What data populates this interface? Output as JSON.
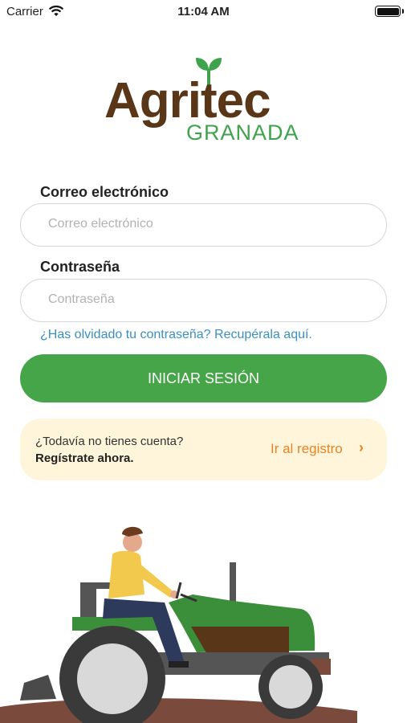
{
  "status_bar": {
    "carrier": "Carrier",
    "time": "11:04 AM",
    "icons": [
      "wifi-icon",
      "battery-icon"
    ]
  },
  "logo": {
    "word": "Agritec",
    "subtitle": "GRANADA",
    "colors": {
      "brown": "#5a3618",
      "green": "#3fa34d"
    }
  },
  "form": {
    "email_label": "Correo electrónico",
    "email_placeholder": "Correo electrónico",
    "email_value": "",
    "password_label": "Contraseña",
    "password_placeholder": "Contraseña",
    "password_value": "",
    "forgot_link": "¿Has olvidado tu contraseña? Recupérala aquí.",
    "login_button": "INICIAR SESIÓN"
  },
  "register": {
    "question": "¿Todavía no tienes cuenta?",
    "cta": "Regístrate ahora.",
    "link": "Ir al registro",
    "chevron": "›"
  },
  "theme": {
    "accent_green": "#45a548",
    "link_blue": "#3a8fbf",
    "orange": "#e98324",
    "banner_bg": "#fef5db"
  },
  "illustration": "farmer-on-tractor"
}
